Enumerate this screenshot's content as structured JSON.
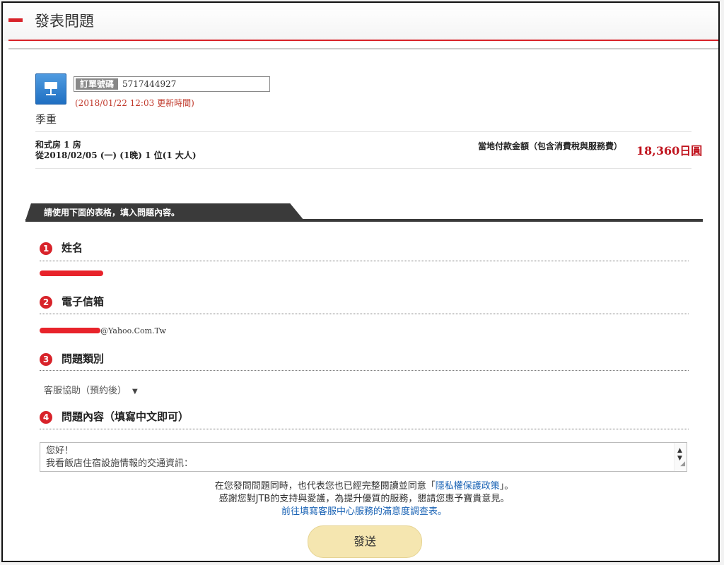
{
  "header": {
    "title": "發表問題"
  },
  "order": {
    "number_label": "訂單號碼",
    "number_value": "5717444927",
    "update_date": "(2018/01/22 12:03",
    "update_label": "更新時間)",
    "hotel_name": "季重"
  },
  "booking": {
    "room_line": "和式房  1 房",
    "date_line": "從2018/02/05 (一)  (1晚)  1 位(1 大人)",
    "payment_label": "當地付款金額（包含消費稅與服務費）",
    "payment_amount": "18,360日圓"
  },
  "form": {
    "tab_label": "請使用下面的表格，填入問題內容。",
    "sections": [
      {
        "num": "1",
        "title": "姓名"
      },
      {
        "num": "2",
        "title": "電子信箱"
      },
      {
        "num": "3",
        "title": "問題類別"
      },
      {
        "num": "4",
        "title": "問題內容（填寫中文即可）"
      }
    ],
    "email_suffix": "@Yahoo.Com.Tw",
    "category_value": "客服協助（預約後）",
    "message_line1": "您好！",
    "message_line2": "我看飯店住宿設施情報的交通資訊：",
    "notice_pre": "在您發問問題同時，也代表您也已經完整閱讀並同意「",
    "privacy_link": "隱私權保護政策",
    "notice_post": "」。",
    "notice_line2": "感謝您對JTB的支持與愛護，為提升優質的服務，懇請您惠予寶貴意見。",
    "survey_link": "前往填寫客服中心服務的滿意度調查表。",
    "send_label": "發送"
  },
  "colors": {
    "accent_red": "#d8232a",
    "link_blue": "#1a63b5",
    "button_yellow": "#f5e6b0"
  }
}
